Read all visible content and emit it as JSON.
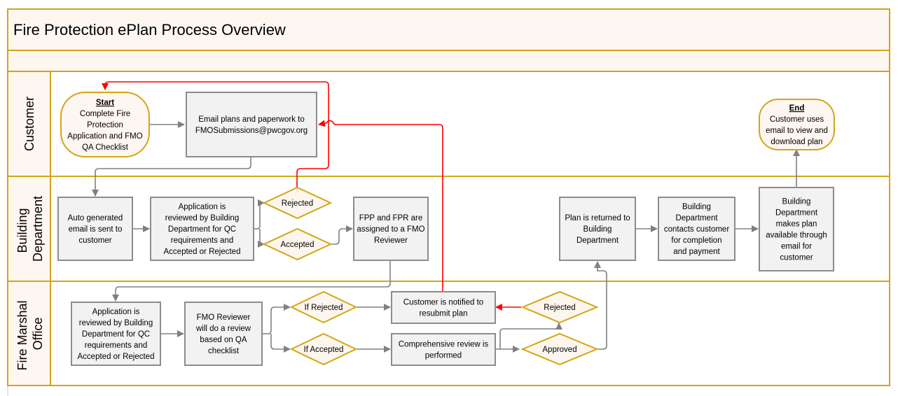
{
  "title": "Fire Protection ePlan Process Overview",
  "colors": {
    "lane_border": "#d4a514",
    "lane_header_fill": "#fdf6f1",
    "process_fill": "#f2f2f2",
    "process_border": "#8c8c8c",
    "decision_fill": "#fdf6ee",
    "decision_border": "#d4a514",
    "connector": "#808080",
    "reject_connector": "#ff0000"
  },
  "lanes": [
    {
      "id": "customer",
      "label_lines": [
        "Customer"
      ]
    },
    {
      "id": "building",
      "label_lines": [
        "Building",
        "Department"
      ]
    },
    {
      "id": "fmo",
      "label_lines": [
        "Fire Marshal",
        "Office"
      ]
    }
  ],
  "nodes": {
    "start": {
      "heading": "Start",
      "lines": [
        "Complete Fire",
        "Protection",
        "Application and FMO",
        "QA Checklist"
      ]
    },
    "email_plans": {
      "lines": [
        "Email plans and paperwork to",
        "FMOSubmissions@pwcgov.org"
      ]
    },
    "end": {
      "heading": "End",
      "lines": [
        "Customer uses",
        "email to view and",
        "download plan"
      ]
    },
    "auto_email": {
      "lines": [
        "Auto generated",
        "email is sent to",
        "customer"
      ]
    },
    "bd_review": {
      "lines": [
        "Application is",
        "reviewed by Building",
        "Department for QC",
        "requirements and",
        "Accepted or Rejected"
      ]
    },
    "bd_rejected": {
      "lines": [
        "Rejected"
      ]
    },
    "bd_accepted": {
      "lines": [
        "Accepted"
      ]
    },
    "assign": {
      "lines": [
        "FPP and FPR are",
        "assigned to a FMO",
        "Reviewer"
      ]
    },
    "returned": {
      "lines": [
        "Plan is returned to",
        "Building",
        "Department"
      ]
    },
    "contacts": {
      "lines": [
        "Building",
        "Department",
        "contacts customer",
        "for completion",
        "and payment"
      ]
    },
    "makes_available": {
      "lines": [
        "Building",
        "Department",
        "makes plan",
        "available through",
        "email for",
        "customer"
      ]
    },
    "fmo_app_review": {
      "lines": [
        "Application is",
        "reviewed by Building",
        "Department for QC",
        "requirements and",
        "Accepted or Rejected"
      ]
    },
    "fmo_reviewer": {
      "lines": [
        "FMO Reviewer",
        "will do a review",
        "based on QA",
        "checklist"
      ]
    },
    "if_rejected": {
      "lines": [
        "If Rejected"
      ]
    },
    "if_accepted": {
      "lines": [
        "If Accepted"
      ]
    },
    "notified": {
      "lines": [
        "Customer is notified to",
        "resubmit plan"
      ]
    },
    "comprehensive": {
      "lines": [
        "Comprehensive review is",
        "performed"
      ]
    },
    "fmo_rejected": {
      "lines": [
        "Rejected"
      ]
    },
    "approved": {
      "lines": [
        "Approved"
      ]
    }
  }
}
